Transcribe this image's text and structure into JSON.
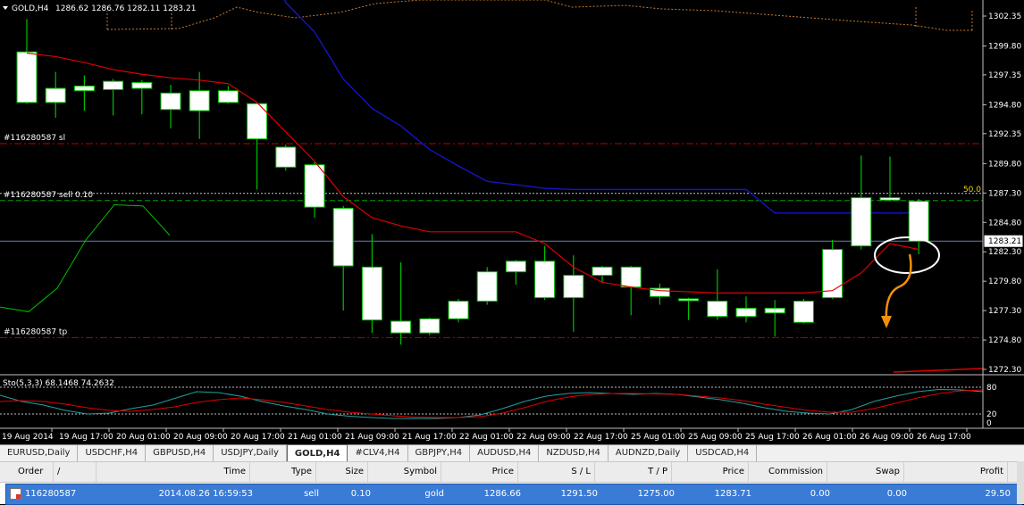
{
  "chart": {
    "title": "GOLD,H4",
    "ohlc": "1286.62 1286.76 1282.11 1283.21",
    "price_labels": [
      "1302.35",
      "1299.80",
      "1297.35",
      "1294.80",
      "1292.35",
      "1289.80",
      "1287.30",
      "1284.80",
      "1282.30",
      "1279.80",
      "1277.30",
      "1274.80",
      "1272.30"
    ],
    "current_price": "1283.21",
    "level_50": "50.0",
    "line_labels": {
      "sl": "#116280587 sl",
      "sell": "#116280587 sell 0.10",
      "tp": "#116280587 tp"
    },
    "stoch_label": "Sto(5,3,3) 68.1468 74.2632",
    "stoch_levels": [
      "80",
      "20",
      "0"
    ],
    "time_labels": [
      "19 Aug 2014",
      "19 Aug 17:00",
      "20 Aug 01:00",
      "20 Aug 09:00",
      "20 Aug 17:00",
      "21 Aug 01:00",
      "21 Aug 09:00",
      "21 Aug 17:00",
      "22 Aug 01:00",
      "22 Aug 09:00",
      "22 Aug 17:00",
      "25 Aug 01:00",
      "25 Aug 09:00",
      "25 Aug 17:00",
      "26 Aug 01:00",
      "26 Aug 09:00",
      "26 Aug 17:00"
    ],
    "colors": {
      "bg": "#000000",
      "bull": "#ffffff",
      "wick": "#00c000",
      "ma_red": "#e00000",
      "ma_blue": "#1414c8",
      "green_line": "#00c000",
      "orange": "#f0900a",
      "dash_red": "#c00000"
    },
    "candles": [
      {
        "o": 1299.3,
        "h": 1302.1,
        "l": 1294.9,
        "c": 1295.0
      },
      {
        "o": 1295.0,
        "h": 1297.6,
        "l": 1293.7,
        "c": 1296.2
      },
      {
        "o": 1296.4,
        "h": 1297.3,
        "l": 1294.3,
        "c": 1296.0
      },
      {
        "o": 1296.1,
        "h": 1297.0,
        "l": 1293.9,
        "c": 1296.8
      },
      {
        "o": 1296.2,
        "h": 1296.9,
        "l": 1294.0,
        "c": 1296.7
      },
      {
        "o": 1295.8,
        "h": 1296.5,
        "l": 1292.8,
        "c": 1294.4
      },
      {
        "o": 1294.3,
        "h": 1297.6,
        "l": 1291.9,
        "c": 1296.0
      },
      {
        "o": 1296.0,
        "h": 1296.4,
        "l": 1294.9,
        "c": 1295.0
      },
      {
        "o": 1294.9,
        "h": 1295.0,
        "l": 1287.6,
        "c": 1291.9
      },
      {
        "o": 1291.2,
        "h": 1291.4,
        "l": 1289.2,
        "c": 1289.5
      },
      {
        "o": 1289.7,
        "h": 1289.9,
        "l": 1285.2,
        "c": 1286.1
      },
      {
        "o": 1286.0,
        "h": 1286.2,
        "l": 1277.3,
        "c": 1281.1
      },
      {
        "o": 1281.0,
        "h": 1283.8,
        "l": 1275.4,
        "c": 1276.5
      },
      {
        "o": 1276.4,
        "h": 1281.4,
        "l": 1274.4,
        "c": 1275.4
      },
      {
        "o": 1275.4,
        "h": 1276.7,
        "l": 1275.2,
        "c": 1276.6
      },
      {
        "o": 1276.6,
        "h": 1278.3,
        "l": 1276.3,
        "c": 1278.1
      },
      {
        "o": 1278.1,
        "h": 1281.0,
        "l": 1277.8,
        "c": 1280.6
      },
      {
        "o": 1280.6,
        "h": 1281.6,
        "l": 1279.5,
        "c": 1281.5
      },
      {
        "o": 1281.5,
        "h": 1282.8,
        "l": 1278.2,
        "c": 1278.4
      },
      {
        "o": 1278.4,
        "h": 1282.0,
        "l": 1275.5,
        "c": 1280.3
      },
      {
        "o": 1280.3,
        "h": 1281.1,
        "l": 1279.7,
        "c": 1281.0
      },
      {
        "o": 1281.0,
        "h": 1281.1,
        "l": 1276.9,
        "c": 1279.3
      },
      {
        "o": 1279.2,
        "h": 1279.6,
        "l": 1277.8,
        "c": 1278.5
      },
      {
        "o": 1278.3,
        "h": 1278.4,
        "l": 1276.5,
        "c": 1278.2
      },
      {
        "o": 1278.1,
        "h": 1280.8,
        "l": 1276.5,
        "c": 1276.8
      },
      {
        "o": 1276.8,
        "h": 1278.5,
        "l": 1276.3,
        "c": 1277.5
      },
      {
        "o": 1277.1,
        "h": 1278.2,
        "l": 1275.1,
        "c": 1277.5
      },
      {
        "o": 1276.3,
        "h": 1278.3,
        "l": 1276.2,
        "c": 1278.1
      },
      {
        "o": 1278.4,
        "h": 1283.3,
        "l": 1278.3,
        "c": 1282.5
      },
      {
        "o": 1282.8,
        "h": 1290.5,
        "l": 1282.5,
        "c": 1286.9
      },
      {
        "o": 1286.9,
        "h": 1290.4,
        "l": 1286.6,
        "c": 1286.7
      },
      {
        "o": 1286.6,
        "h": 1286.8,
        "l": 1282.1,
        "c": 1283.2
      }
    ],
    "ma_red": [
      1299.2,
      1298.9,
      1298.4,
      1297.8,
      1297.4,
      1297.1,
      1296.9,
      1296.6,
      1295.0,
      1292.5,
      1290.0,
      1287.0,
      1285.2,
      1284.5,
      1284.0,
      1284.0,
      1284.0,
      1284.0,
      1283.0,
      1281.0,
      1279.7,
      1279.3,
      1279.0,
      1278.9,
      1278.8,
      1278.8,
      1278.8,
      1278.8,
      1279.0,
      1280.5,
      1283.0,
      1282.5
    ],
    "ma_blue": [
      1310,
      1310,
      1310,
      1310,
      1310,
      1310,
      1310,
      1310,
      1309.5,
      1303.5,
      1301.0,
      1297.0,
      1294.5,
      1293.0,
      1291.0,
      1289.6,
      1288.3,
      1288.0,
      1287.7,
      1287.6,
      1287.6,
      1287.6,
      1287.6,
      1287.6,
      1287.6,
      1287.6,
      1285.6,
      1285.6,
      1285.6,
      1285.6,
      1285.6,
      1285.6
    ],
    "green_line": [
      1277.6,
      1277.2,
      1279.2,
      1283.3,
      1286.3,
      1286.2,
      1283.7
    ],
    "stoch_main": [
      62,
      48,
      40,
      28,
      20,
      22,
      32,
      40,
      55,
      70,
      68,
      60,
      48,
      38,
      30,
      20,
      15,
      12,
      10,
      10,
      10,
      12,
      18,
      32,
      48,
      60,
      66,
      68,
      66,
      64,
      66,
      64,
      58,
      52,
      44,
      34,
      26,
      22,
      20,
      30,
      48,
      60,
      70,
      75,
      74,
      70
    ],
    "stoch_signal": [
      48,
      50,
      48,
      42,
      34,
      28,
      26,
      30,
      36,
      46,
      52,
      56,
      52,
      46,
      38,
      30,
      24,
      20,
      16,
      13,
      12,
      12,
      14,
      22,
      34,
      48,
      58,
      64,
      66,
      66,
      65,
      64,
      60,
      56,
      50,
      42,
      35,
      28,
      24,
      24,
      32,
      44,
      56,
      66,
      72,
      74
    ],
    "sl_price": 1291.5,
    "sell_price": 1286.66,
    "tp_price": 1275.0,
    "bid_price": 1283.21
  },
  "tabs": [
    {
      "label": "EURUSD,Daily"
    },
    {
      "label": "USDCHF,H4"
    },
    {
      "label": "GBPUSD,H4"
    },
    {
      "label": "USDJPY,Daily"
    },
    {
      "label": "GOLD,H4",
      "active": true
    },
    {
      "label": "#CLV4,H4"
    },
    {
      "label": "GBPJPY,H4"
    },
    {
      "label": "AUDUSD,H4"
    },
    {
      "label": "NZDUSD,H4"
    },
    {
      "label": "AUDNZD,Daily"
    },
    {
      "label": "USDCAD,H4"
    }
  ],
  "terminal": {
    "headers": [
      "Order",
      "/",
      "Time",
      "Type",
      "Size",
      "Symbol",
      "Price",
      "S / L",
      "T / P",
      "Price",
      "Commission",
      "Swap",
      "Profit"
    ],
    "row": {
      "order": "116280587",
      "time": "2014.08.26 16:59:53",
      "type": "sell",
      "size": "0.10",
      "symbol": "gold",
      "price": "1286.66",
      "sl": "1291.50",
      "tp": "1275.00",
      "cur_price": "1283.71",
      "commission": "0.00",
      "swap": "0.00",
      "profit": "29.50"
    }
  }
}
